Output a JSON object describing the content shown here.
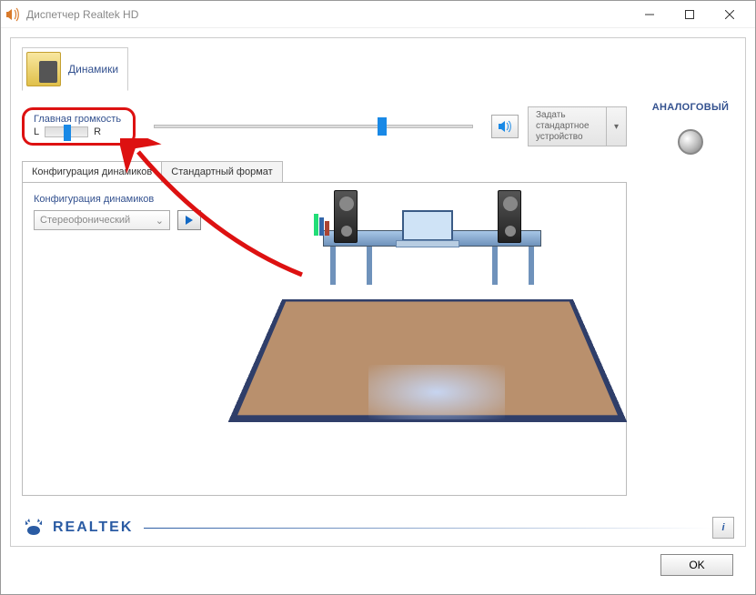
{
  "window": {
    "title": "Диспетчер Realtek HD"
  },
  "device": {
    "speakers_label": "Динамики"
  },
  "volume": {
    "section_title": "Главная громкость",
    "left_letter": "L",
    "right_letter": "R"
  },
  "default_device": {
    "line1": "Задать",
    "line2": "стандартное",
    "line3": "устройство"
  },
  "right_panel": {
    "analog_label": "АНАЛОГОВЫЙ"
  },
  "tabs": {
    "speaker_config": "Конфигурация динамиков",
    "default_format": "Стандартный формат"
  },
  "config": {
    "label": "Конфигурация динамиков",
    "dropdown_value": "Стереофонический"
  },
  "footer": {
    "brand": "REALTEK",
    "ok": "OK"
  }
}
